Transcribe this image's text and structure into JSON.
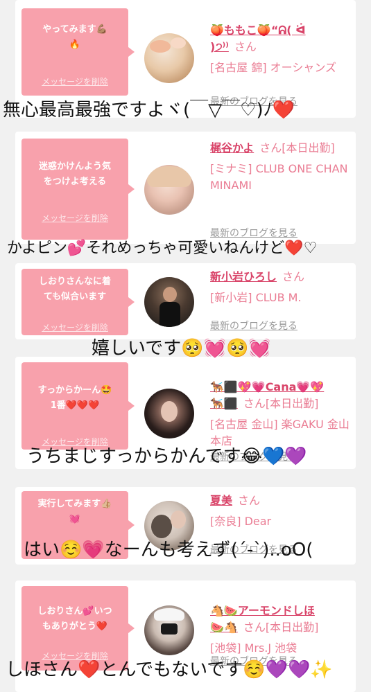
{
  "delete_label": "メッセージを削除",
  "blog_label": "最新のブログを見る",
  "cards": [
    {
      "message": "やってみます💪🏽\n🔥",
      "name": "🍑ももこ🍑“ᕱ( ᐛ\n)੭⁾⁾",
      "honorific": "さん",
      "shop": "[名古屋 錦] オーシャンズ"
    },
    {
      "message": "迷惑かけんよう気\nをつけよ考える",
      "name": "梶谷かよ",
      "honorific": "さん[本日出勤]",
      "shop": "[ミナミ] CLUB ONE CHAN MINAMI"
    },
    {
      "message": "しおりさんなに着\nても似合います",
      "name": "新小岩ひろし",
      "honorific": "さん",
      "shop": "[新小岩] CLUB M."
    },
    {
      "message": "すっからかーん🤩\n1番❤️❤️❤️",
      "name": "🐕‍🦺⬛💖💗Cana💗💖\n🐕‍🦺⬛",
      "honorific": "さん[本日出勤]",
      "shop": "[名古屋 金山] 楽GAKU 金山本店"
    },
    {
      "message": "実行してみます👍🏼\n💓",
      "name": "夏美",
      "honorific": "さん",
      "shop": "[奈良] Dear"
    },
    {
      "message": "しおりさん💕いつ\nもありがとう❤️",
      "name": "🐴🍉アーモンドしほ\n🍉🐴",
      "honorific": "さん[本日出勤]",
      "shop": "[池袋] Mrs.J 池袋"
    }
  ],
  "overlays": [
    "無心最高最強ですよヾ(￣▽￣♡)ﾉ❤️",
    "かよピン💕それめっちゃ可愛いねんけど❤️♡",
    "嬉しいです🥺💓🥺💓",
    "うちまじすっからかんです😂💙💜",
    "はい☺️💗なーんも考えず(´-`)..oO(",
    "しほさん❤️とんでもないです☺️💜💜✨"
  ]
}
